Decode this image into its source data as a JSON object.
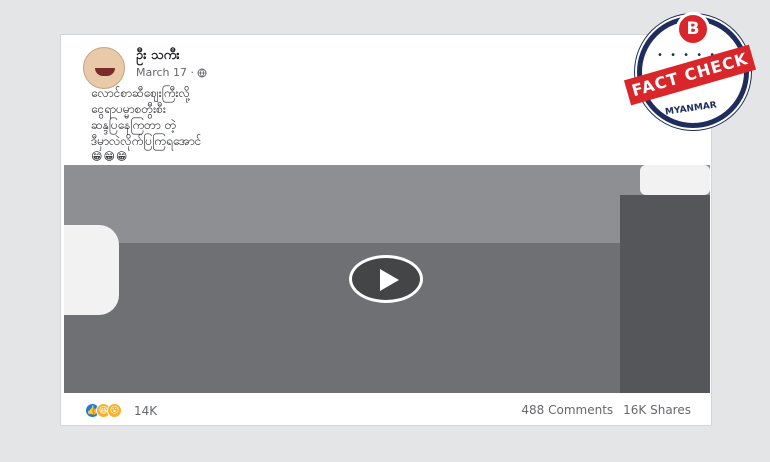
{
  "post": {
    "author": "ဦး သကီး",
    "date": "March 17 ·",
    "privacy_icon": "globe-icon",
    "text_lines": [
      "လောင်စာဆီဈေးကြီးလို့",
      "ငွေရာပမ္မာစတွီးစီး",
      "ဆန္ဒပြနေကြတာ တဲ့",
      "ဒီမှာလဲလိုက်ပြကြရအောင်"
    ],
    "emojis": "😁😁😁"
  },
  "video": {
    "play_icon": "play-icon"
  },
  "footer": {
    "reaction_icons": [
      "like-icon",
      "haha-icon",
      "wow-icon"
    ],
    "reaction_count": "14K",
    "comments": "488 Comments",
    "shares": "16K Shares"
  },
  "stamp": {
    "logo_letter": "B",
    "banner": "FACT CHECK",
    "country": "MYANMAR"
  },
  "colors": {
    "stamp_red": "#d9262a",
    "stamp_navy": "#1f2d5c",
    "like_blue": "#1877f2"
  }
}
